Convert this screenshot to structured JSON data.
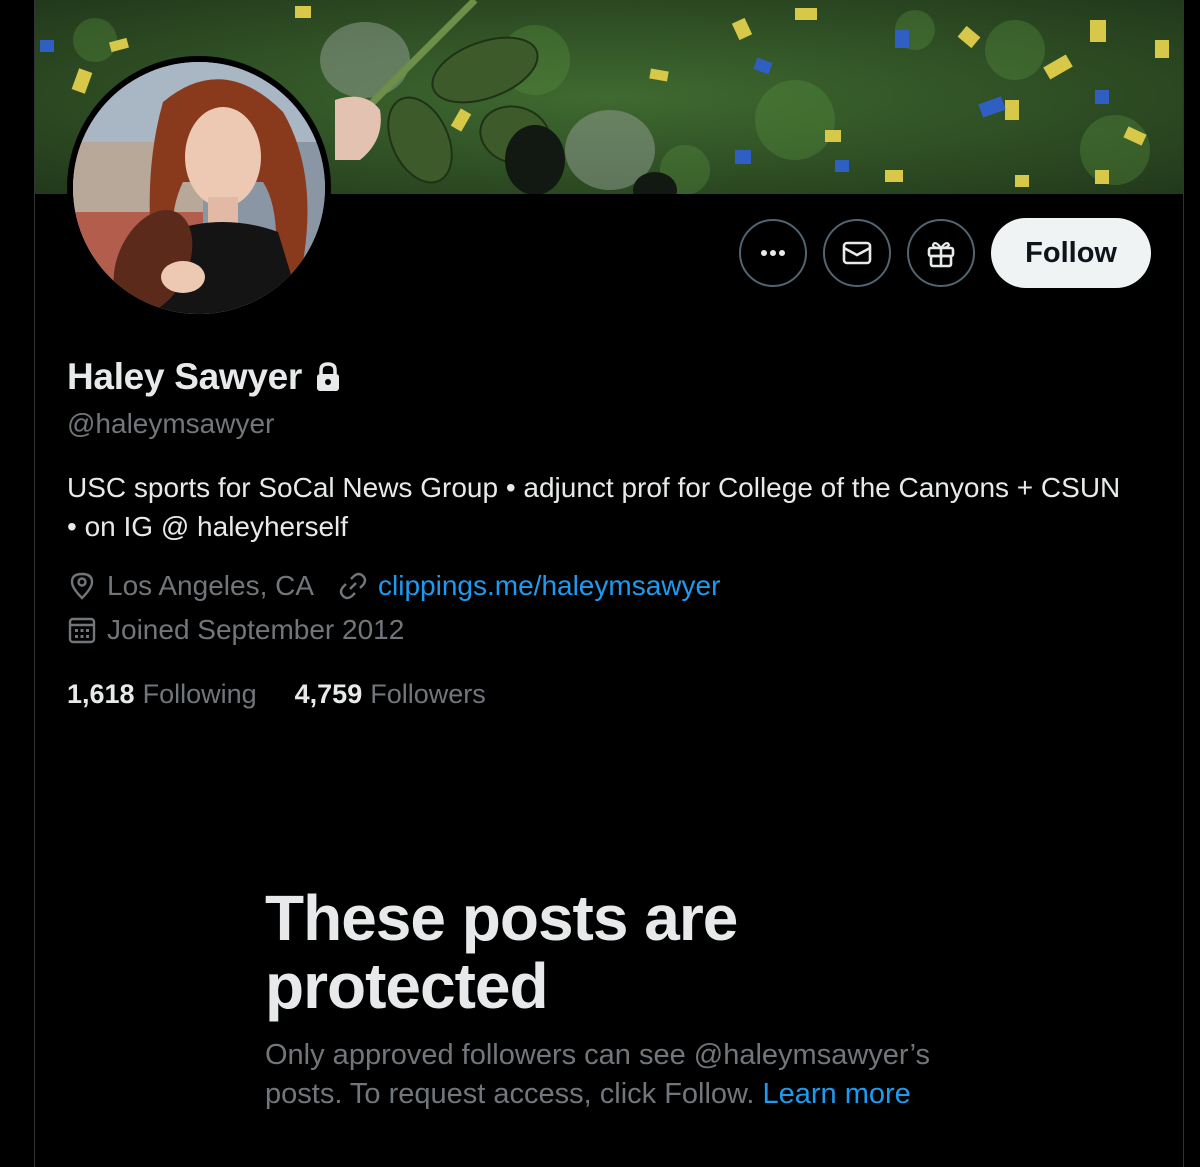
{
  "profile": {
    "display_name": "Haley Sawyer",
    "handle": "@haleymsawyer",
    "bio": "USC sports for SoCal News Group • adjunct prof for College of the Canyons + CSUN • on IG @ haleyherself",
    "location": "Los Angeles, CA",
    "website": "clippings.me/haleymsawyer",
    "joined": "Joined September 2012",
    "protected": true
  },
  "actions": {
    "more_icon": "more-horizontal-icon",
    "message_icon": "envelope-icon",
    "gift_icon": "gift-icon",
    "follow_label": "Follow"
  },
  "stats": {
    "following_count": "1,618",
    "following_label": "Following",
    "followers_count": "4,759",
    "followers_label": "Followers"
  },
  "protected_notice": {
    "title": "These posts are protected",
    "body": "Only approved followers can see @haleymsawyer’s posts. To request access, click Follow.",
    "link": "Learn more"
  },
  "colors": {
    "background": "#000000",
    "text_primary": "#e7e9ea",
    "text_secondary": "#71767b",
    "accent": "#1d9bf0",
    "follow_button_bg": "#eff3f4"
  }
}
